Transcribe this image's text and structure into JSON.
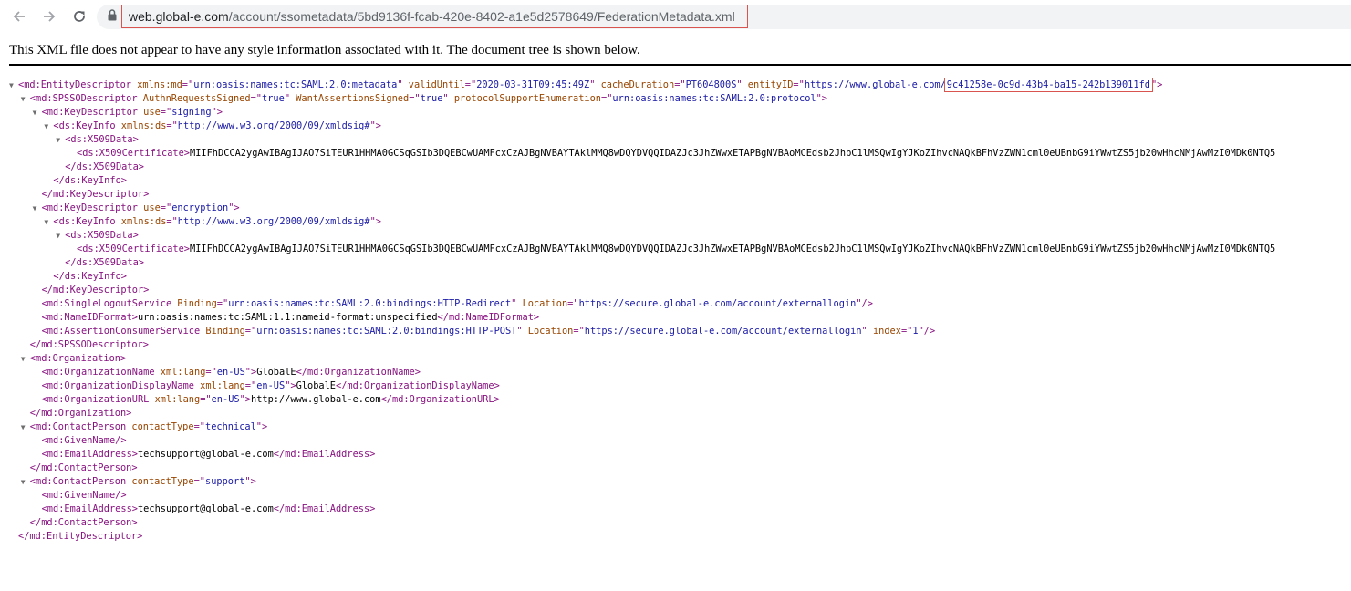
{
  "browser": {
    "url_host": "web.global-e.com",
    "url_path": "/account/ssometadata/5bd9136f-fcab-420e-8402-a1e5d2578649/FederationMetadata.xml",
    "icons": [
      "back-arrow-icon",
      "forward-arrow-icon",
      "reload-icon",
      "lock-icon"
    ],
    "colors": {
      "omnibox_bg": "#f1f3f4",
      "highlight_border": "#d9534f"
    }
  },
  "notice": "This XML file does not appear to have any style information associated with it. The document tree is shown below.",
  "xml": {
    "colors": {
      "tag": "#881280",
      "attr_name": "#994500",
      "attr_value": "#1a1aa6",
      "text": "#000000"
    },
    "lines": [
      {
        "depth": 0,
        "toggle": true,
        "parts": [
          [
            "tag",
            "<md:EntityDescriptor"
          ],
          [
            "an",
            " xmlns:md"
          ],
          [
            "tag",
            "=\""
          ],
          [
            "av",
            "urn:oasis:names:tc:SAML:2.0:metadata"
          ],
          [
            "tag",
            "\""
          ],
          [
            "an",
            " validUntil"
          ],
          [
            "tag",
            "=\""
          ],
          [
            "av",
            "2020-03-31T09:45:49Z"
          ],
          [
            "tag",
            "\""
          ],
          [
            "an",
            " cacheDuration"
          ],
          [
            "tag",
            "=\""
          ],
          [
            "av",
            "PT604800S"
          ],
          [
            "tag",
            "\""
          ],
          [
            "an",
            " entityID"
          ],
          [
            "tag",
            "=\""
          ],
          [
            "av",
            "https://www.global-e.com/"
          ],
          [
            "avh",
            "9c41258e-0c9d-43b4-ba15-242b139011fd"
          ],
          [
            "tag",
            "\">"
          ]
        ]
      },
      {
        "depth": 1,
        "toggle": true,
        "parts": [
          [
            "tag",
            "<md:SPSSODescriptor"
          ],
          [
            "an",
            " AuthnRequestsSigned"
          ],
          [
            "tag",
            "=\""
          ],
          [
            "av",
            "true"
          ],
          [
            "tag",
            "\""
          ],
          [
            "an",
            " WantAssertionsSigned"
          ],
          [
            "tag",
            "=\""
          ],
          [
            "av",
            "true"
          ],
          [
            "tag",
            "\""
          ],
          [
            "an",
            " protocolSupportEnumeration"
          ],
          [
            "tag",
            "=\""
          ],
          [
            "av",
            "urn:oasis:names:tc:SAML:2.0:protocol"
          ],
          [
            "tag",
            "\">"
          ]
        ]
      },
      {
        "depth": 2,
        "toggle": true,
        "parts": [
          [
            "tag",
            "<md:KeyDescriptor"
          ],
          [
            "an",
            " use"
          ],
          [
            "tag",
            "=\""
          ],
          [
            "av",
            "signing"
          ],
          [
            "tag",
            "\">"
          ]
        ]
      },
      {
        "depth": 3,
        "toggle": true,
        "parts": [
          [
            "tag",
            "<ds:KeyInfo"
          ],
          [
            "an",
            " xmlns:ds"
          ],
          [
            "tag",
            "=\""
          ],
          [
            "av",
            "http://www.w3.org/2000/09/xmldsig#"
          ],
          [
            "tag",
            "\">"
          ]
        ]
      },
      {
        "depth": 4,
        "toggle": true,
        "parts": [
          [
            "tag",
            "<ds:X509Data>"
          ]
        ]
      },
      {
        "depth": 5,
        "toggle": false,
        "parts": [
          [
            "tag",
            "<ds:X509Certificate>"
          ],
          [
            "tx",
            "MIIFhDCCA2ygAwIBAgIJAO7SiTEUR1HHMA0GCSqGSIb3DQEBCwUAMFcxCzAJBgNVBAYTAklMMQ8wDQYDVQQIDAZJc3JhZWwxETAPBgNVBAoMCEdsb2JhbC1lMSQwIgYJKoZIhvcNAQkBFhVzZWN1cml0eUBnbG9iYWwtZS5jb20wHhcNMjAwMzI0MDk0NTQ5"
          ]
        ]
      },
      {
        "depth": 4,
        "toggle": false,
        "parts": [
          [
            "tag",
            "</ds:X509Data>"
          ]
        ]
      },
      {
        "depth": 3,
        "toggle": false,
        "parts": [
          [
            "tag",
            "</ds:KeyInfo>"
          ]
        ]
      },
      {
        "depth": 2,
        "toggle": false,
        "parts": [
          [
            "tag",
            "</md:KeyDescriptor>"
          ]
        ]
      },
      {
        "depth": 2,
        "toggle": true,
        "parts": [
          [
            "tag",
            "<md:KeyDescriptor"
          ],
          [
            "an",
            " use"
          ],
          [
            "tag",
            "=\""
          ],
          [
            "av",
            "encryption"
          ],
          [
            "tag",
            "\">"
          ]
        ]
      },
      {
        "depth": 3,
        "toggle": true,
        "parts": [
          [
            "tag",
            "<ds:KeyInfo"
          ],
          [
            "an",
            " xmlns:ds"
          ],
          [
            "tag",
            "=\""
          ],
          [
            "av",
            "http://www.w3.org/2000/09/xmldsig#"
          ],
          [
            "tag",
            "\">"
          ]
        ]
      },
      {
        "depth": 4,
        "toggle": true,
        "parts": [
          [
            "tag",
            "<ds:X509Data>"
          ]
        ]
      },
      {
        "depth": 5,
        "toggle": false,
        "parts": [
          [
            "tag",
            "<ds:X509Certificate>"
          ],
          [
            "tx",
            "MIIFhDCCA2ygAwIBAgIJAO7SiTEUR1HHMA0GCSqGSIb3DQEBCwUAMFcxCzAJBgNVBAYTAklMMQ8wDQYDVQQIDAZJc3JhZWwxETAPBgNVBAoMCEdsb2JhbC1lMSQwIgYJKoZIhvcNAQkBFhVzZWN1cml0eUBnbG9iYWwtZS5jb20wHhcNMjAwMzI0MDk0NTQ5"
          ]
        ]
      },
      {
        "depth": 4,
        "toggle": false,
        "parts": [
          [
            "tag",
            "</ds:X509Data>"
          ]
        ]
      },
      {
        "depth": 3,
        "toggle": false,
        "parts": [
          [
            "tag",
            "</ds:KeyInfo>"
          ]
        ]
      },
      {
        "depth": 2,
        "toggle": false,
        "parts": [
          [
            "tag",
            "</md:KeyDescriptor>"
          ]
        ]
      },
      {
        "depth": 2,
        "toggle": false,
        "parts": [
          [
            "tag",
            "<md:SingleLogoutService"
          ],
          [
            "an",
            " Binding"
          ],
          [
            "tag",
            "=\""
          ],
          [
            "av",
            "urn:oasis:names:tc:SAML:2.0:bindings:HTTP-Redirect"
          ],
          [
            "tag",
            "\""
          ],
          [
            "an",
            " Location"
          ],
          [
            "tag",
            "=\""
          ],
          [
            "av",
            "https://secure.global-e.com/account/externallogin"
          ],
          [
            "tag",
            "\"/>"
          ]
        ]
      },
      {
        "depth": 2,
        "toggle": false,
        "parts": [
          [
            "tag",
            "<md:NameIDFormat>"
          ],
          [
            "tx",
            "urn:oasis:names:tc:SAML:1.1:nameid-format:unspecified"
          ],
          [
            "tag",
            "</md:NameIDFormat>"
          ]
        ]
      },
      {
        "depth": 2,
        "toggle": false,
        "parts": [
          [
            "tag",
            "<md:AssertionConsumerService"
          ],
          [
            "an",
            " Binding"
          ],
          [
            "tag",
            "=\""
          ],
          [
            "av",
            "urn:oasis:names:tc:SAML:2.0:bindings:HTTP-POST"
          ],
          [
            "tag",
            "\""
          ],
          [
            "an",
            " Location"
          ],
          [
            "tag",
            "=\""
          ],
          [
            "av",
            "https://secure.global-e.com/account/externallogin"
          ],
          [
            "tag",
            "\""
          ],
          [
            "an",
            " index"
          ],
          [
            "tag",
            "=\""
          ],
          [
            "av",
            "1"
          ],
          [
            "tag",
            "\"/>"
          ]
        ]
      },
      {
        "depth": 1,
        "toggle": false,
        "parts": [
          [
            "tag",
            "</md:SPSSODescriptor>"
          ]
        ]
      },
      {
        "depth": 1,
        "toggle": true,
        "parts": [
          [
            "tag",
            "<md:Organization>"
          ]
        ]
      },
      {
        "depth": 2,
        "toggle": false,
        "parts": [
          [
            "tag",
            "<md:OrganizationName"
          ],
          [
            "an",
            " xml:lang"
          ],
          [
            "tag",
            "=\""
          ],
          [
            "av",
            "en-US"
          ],
          [
            "tag",
            "\">"
          ],
          [
            "tx",
            "GlobalE"
          ],
          [
            "tag",
            "</md:OrganizationName>"
          ]
        ]
      },
      {
        "depth": 2,
        "toggle": false,
        "parts": [
          [
            "tag",
            "<md:OrganizationDisplayName"
          ],
          [
            "an",
            " xml:lang"
          ],
          [
            "tag",
            "=\""
          ],
          [
            "av",
            "en-US"
          ],
          [
            "tag",
            "\">"
          ],
          [
            "tx",
            "GlobalE"
          ],
          [
            "tag",
            "</md:OrganizationDisplayName>"
          ]
        ]
      },
      {
        "depth": 2,
        "toggle": false,
        "parts": [
          [
            "tag",
            "<md:OrganizationURL"
          ],
          [
            "an",
            " xml:lang"
          ],
          [
            "tag",
            "=\""
          ],
          [
            "av",
            "en-US"
          ],
          [
            "tag",
            "\">"
          ],
          [
            "tx",
            "http://www.global-e.com"
          ],
          [
            "tag",
            "</md:OrganizationURL>"
          ]
        ]
      },
      {
        "depth": 1,
        "toggle": false,
        "parts": [
          [
            "tag",
            "</md:Organization>"
          ]
        ]
      },
      {
        "depth": 1,
        "toggle": true,
        "parts": [
          [
            "tag",
            "<md:ContactPerson"
          ],
          [
            "an",
            " contactType"
          ],
          [
            "tag",
            "=\""
          ],
          [
            "av",
            "technical"
          ],
          [
            "tag",
            "\">"
          ]
        ]
      },
      {
        "depth": 2,
        "toggle": false,
        "parts": [
          [
            "tag",
            "<md:GivenName/>"
          ]
        ]
      },
      {
        "depth": 2,
        "toggle": false,
        "parts": [
          [
            "tag",
            "<md:EmailAddress>"
          ],
          [
            "tx",
            "techsupport@global-e.com"
          ],
          [
            "tag",
            "</md:EmailAddress>"
          ]
        ]
      },
      {
        "depth": 1,
        "toggle": false,
        "parts": [
          [
            "tag",
            "</md:ContactPerson>"
          ]
        ]
      },
      {
        "depth": 1,
        "toggle": true,
        "parts": [
          [
            "tag",
            "<md:ContactPerson"
          ],
          [
            "an",
            " contactType"
          ],
          [
            "tag",
            "=\""
          ],
          [
            "av",
            "support"
          ],
          [
            "tag",
            "\">"
          ]
        ]
      },
      {
        "depth": 2,
        "toggle": false,
        "parts": [
          [
            "tag",
            "<md:GivenName/>"
          ]
        ]
      },
      {
        "depth": 2,
        "toggle": false,
        "parts": [
          [
            "tag",
            "<md:EmailAddress>"
          ],
          [
            "tx",
            "techsupport@global-e.com"
          ],
          [
            "tag",
            "</md:EmailAddress>"
          ]
        ]
      },
      {
        "depth": 1,
        "toggle": false,
        "parts": [
          [
            "tag",
            "</md:ContactPerson>"
          ]
        ]
      },
      {
        "depth": 0,
        "toggle": false,
        "parts": [
          [
            "tag",
            "</md:EntityDescriptor>"
          ]
        ]
      }
    ]
  }
}
